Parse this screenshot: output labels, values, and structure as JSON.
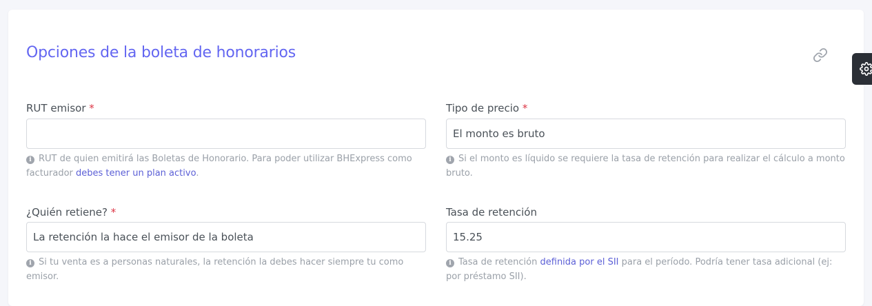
{
  "section": {
    "title": "Opciones de la boleta de honorarios"
  },
  "required_mark": "*",
  "fields": {
    "rut_emisor": {
      "label": "RUT emisor",
      "value": "",
      "help_text": "RUT de quien emitirá las Boletas de Honorario. Para poder utilizar BHExpress como facturador ",
      "help_link": "debes tener un plan activo",
      "help_after": "."
    },
    "tipo_precio": {
      "label": "Tipo de precio",
      "value": "El monto es bruto",
      "help_text": "Si el monto es líquido se requiere la tasa de retención para realizar el cálculo a monto bruto."
    },
    "quien_retiene": {
      "label": "¿Quién retiene?",
      "value": "La retención la hace el emisor de la boleta",
      "help_text": "Si tu venta es a personas naturales, la retención la debes hacer siempre tu como emisor."
    },
    "tasa_retencion": {
      "label": "Tasa de retención",
      "value": "15.25",
      "help_text": "Tasa de retención ",
      "help_link": "definida por el SII",
      "help_after": " para el período. Podría tener tasa adicional (ej: por préstamo SII)."
    }
  },
  "icons": {
    "link": "link-icon",
    "settings": "gear-icon",
    "info": "info-icon"
  },
  "colors": {
    "accent": "#6366f1",
    "required": "#dc3545",
    "link": "#5b5fd6",
    "settings_tab": "#2b2f36"
  }
}
